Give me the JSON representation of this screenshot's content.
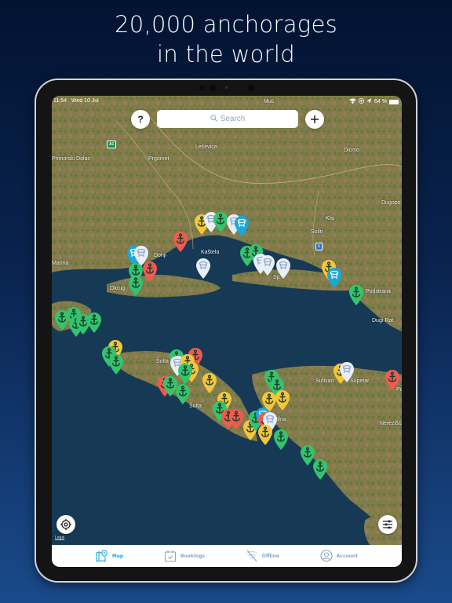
{
  "headline": {
    "line1": "20,000 anchorages",
    "line2": "in the world"
  },
  "status_bar": {
    "time": "11:54",
    "date": "Wed 10 Jul",
    "battery": "64 %"
  },
  "toolbar": {
    "help_label": "?",
    "search_placeholder": "Search",
    "add_label": "+"
  },
  "map": {
    "labels": [
      {
        "id": "muc",
        "text": "Muć"
      },
      {
        "id": "lecevica",
        "text": "Lećevica"
      },
      {
        "id": "primorski-dolac",
        "text": "Primorski Dolac"
      },
      {
        "id": "prgomet",
        "text": "Prgomet"
      },
      {
        "id": "dicmo",
        "text": "Dicmo"
      },
      {
        "id": "dugopolje",
        "text": "Dugopo"
      },
      {
        "id": "klis",
        "text": "Klis"
      },
      {
        "id": "solin",
        "text": "Solin"
      },
      {
        "id": "kastela",
        "text": "Kaštela"
      },
      {
        "id": "donji",
        "text": "Donji"
      },
      {
        "id": "marina",
        "text": "Marina"
      },
      {
        "id": "okrug",
        "text": "Okrug"
      },
      {
        "id": "split",
        "text": "Sp"
      },
      {
        "id": "podstrana",
        "text": "Podstrana"
      },
      {
        "id": "dugi-rat",
        "text": "Dugi Rat"
      },
      {
        "id": "solta",
        "text": "Šolta"
      },
      {
        "id": "solta2",
        "text": "Šolta"
      },
      {
        "id": "sutivan",
        "text": "Sutivan"
      },
      {
        "id": "supetar",
        "text": "Supetar"
      },
      {
        "id": "po",
        "text": "Po"
      },
      {
        "id": "milna",
        "text": "Milna"
      },
      {
        "id": "nerezisca",
        "text": "Nerezišća"
      }
    ],
    "road_badges": [
      {
        "id": "a1",
        "text": "A1",
        "color": "#1b8a4a"
      },
      {
        "id": "r1",
        "text": "1",
        "color": "#2a6fd6"
      }
    ],
    "pin_colors": {
      "green": "#34c46e",
      "yellow": "#f5c53a",
      "red": "#ef5b50",
      "white": "#e8eef6",
      "blue": "#1aa8dc"
    },
    "legal_label": "Legal"
  },
  "tabbar": {
    "tabs": [
      {
        "id": "map",
        "label": "Map",
        "active": true
      },
      {
        "id": "bookings",
        "label": "Bookings",
        "active": false
      },
      {
        "id": "offline",
        "label": "Offline",
        "active": false
      },
      {
        "id": "account",
        "label": "Account",
        "active": false
      }
    ]
  }
}
